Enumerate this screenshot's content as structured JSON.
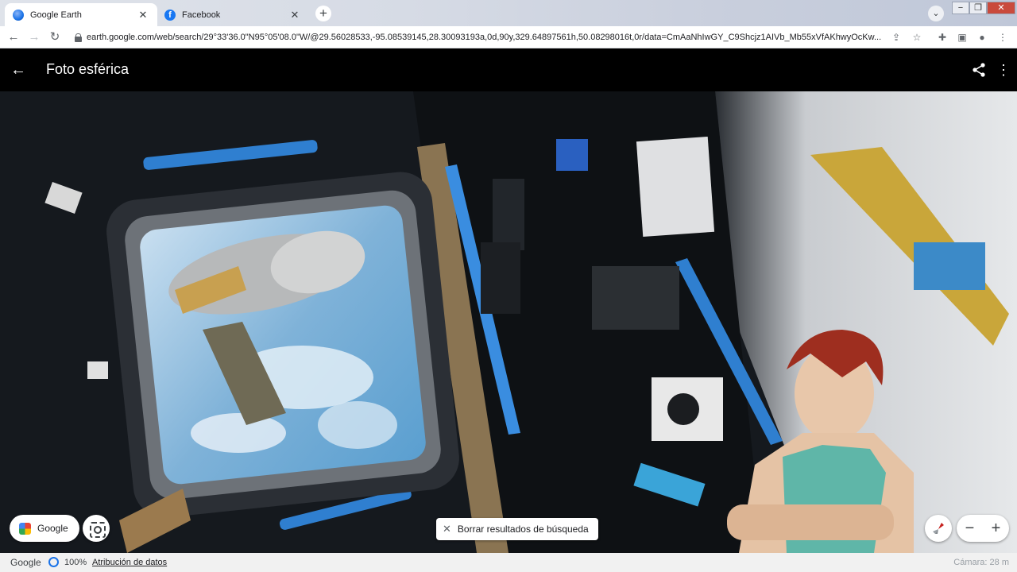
{
  "browser": {
    "tabs": [
      {
        "title": "Google Earth",
        "active": true,
        "favicon": "earth-favicon"
      },
      {
        "title": "Facebook",
        "active": false,
        "favicon": "facebook-favicon"
      }
    ],
    "close_glyph": "✕",
    "new_tab_glyph": "+",
    "url": "earth.google.com/web/search/29°33'36.0\"N95°05'08.0\"W/@29.56028533,-95.08539145,28.30093193a,0d,90y,329.64897561h,50.08298016t,0r/data=CmAaNhIwGY_C9Shcjz1AIVb_Mb55xVfAKhwyOcKw..."
  },
  "header": {
    "title": "Foto esférica"
  },
  "controls": {
    "google_button_label": "Google",
    "clear_results_label": "Borrar resultados de búsqueda",
    "zoom_out": "−",
    "zoom_in": "+"
  },
  "status": {
    "logo_text": "Google",
    "zoom": "100%",
    "attribution": "Atribución de datos",
    "camera": "Cámara: 28 m"
  },
  "colors": {
    "accent": "#1a73e8",
    "header_bg": "#000000",
    "facebook_blue": "#1877f2"
  }
}
